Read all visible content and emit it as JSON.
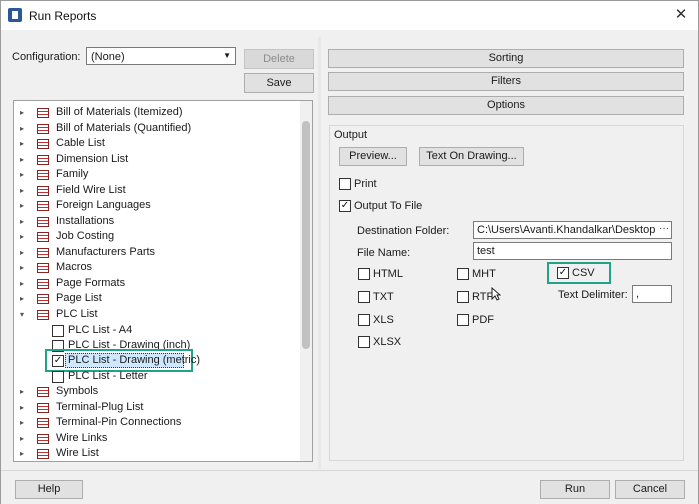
{
  "window": {
    "title": "Run Reports",
    "close_glyph": "✕"
  },
  "config": {
    "label": "Configuration:",
    "value": "(None)",
    "delete_label": "Delete",
    "save_label": "Save"
  },
  "tree": {
    "items": [
      {
        "label": "Bill of Materials (Itemized)"
      },
      {
        "label": "Bill of Materials (Quantified)"
      },
      {
        "label": "Cable List"
      },
      {
        "label": "Dimension List"
      },
      {
        "label": "Family"
      },
      {
        "label": "Field Wire List"
      },
      {
        "label": "Foreign Languages"
      },
      {
        "label": "Installations"
      },
      {
        "label": "Job Costing"
      },
      {
        "label": "Manufacturers Parts"
      },
      {
        "label": "Macros"
      },
      {
        "label": "Page Formats"
      },
      {
        "label": "Page List"
      },
      {
        "label": "PLC List"
      },
      {
        "label": "PLC List - A4",
        "checked": false
      },
      {
        "label": "PLC List - Drawing (inch)",
        "checked": false
      },
      {
        "label": "PLC List - Drawing (metric)",
        "checked": true
      },
      {
        "label": "PLC List - Letter",
        "checked": false
      },
      {
        "label": "Symbols"
      },
      {
        "label": "Terminal-Plug List"
      },
      {
        "label": "Terminal-Pin Connections"
      },
      {
        "label": "Wire Links"
      },
      {
        "label": "Wire List"
      }
    ]
  },
  "right": {
    "sorting_label": "Sorting",
    "filters_label": "Filters",
    "options_label": "Options",
    "output_label": "Output",
    "preview_label": "Preview...",
    "text_on_drawing_label": "Text On Drawing...",
    "print_label": "Print",
    "print_checked": false,
    "output_to_file_label": "Output To File",
    "output_to_file_checked": true,
    "dest_folder_label": "Destination Folder:",
    "dest_folder_value": "C:\\Users\\Avanti.Khandalkar\\Desktop",
    "browse_label": "···",
    "file_name_label": "File Name:",
    "file_name_value": "test",
    "formats": {
      "html": "HTML",
      "mht": "MHT",
      "csv": "CSV",
      "txt": "TXT",
      "rtf": "RTF",
      "xls": "XLS",
      "pdf": "PDF",
      "xlsx": "XLSX"
    },
    "csv_checked": true,
    "text_delimiter_label": "Text Delimiter:",
    "text_delimiter_value": ","
  },
  "footer": {
    "help_label": "Help",
    "run_label": "Run",
    "cancel_label": "Cancel"
  },
  "colors": {
    "highlight": "#21a38a",
    "selection": "#cde8ff"
  }
}
